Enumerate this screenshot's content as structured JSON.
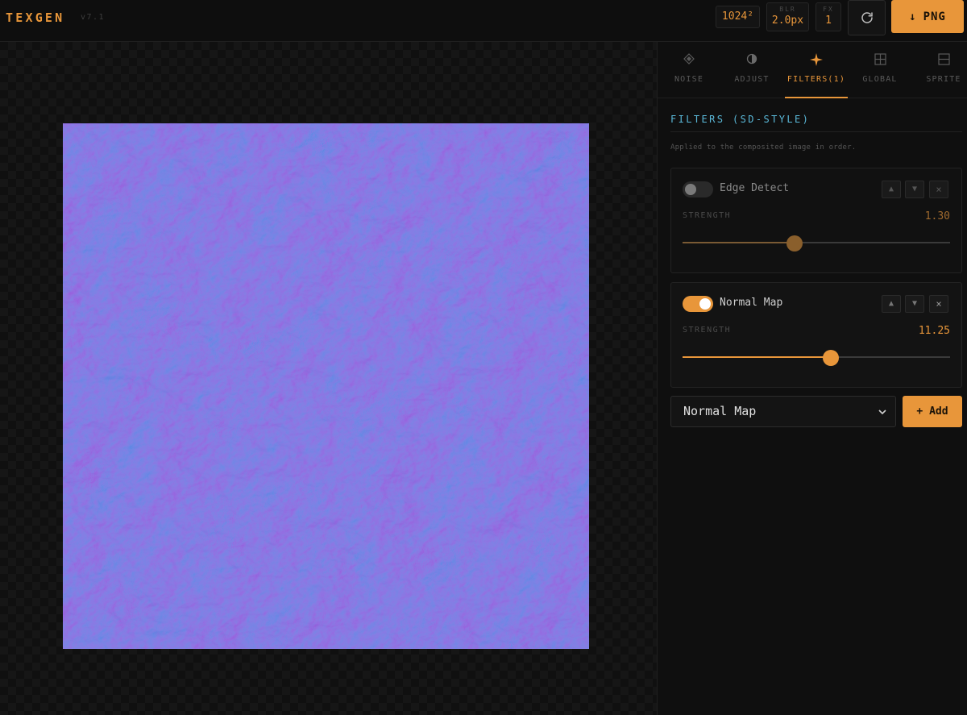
{
  "app": {
    "name": "TEXGEN",
    "version": "v7.1"
  },
  "toolbar": {
    "resolution": "1024²",
    "blur_label": "BLR",
    "blur_value": "2.0px",
    "fx_label": "FX",
    "fx_value": "1",
    "refresh_icon": "refresh-icon",
    "export_label": "PNG",
    "export_icon": "download-arrow-icon"
  },
  "tabs": [
    {
      "label": "NOISE",
      "icon": "diamond-icon"
    },
    {
      "label": "ADJUST",
      "icon": "half-circle-icon"
    },
    {
      "label": "FILTERS(1)",
      "icon": "sparkle-icon",
      "active": true
    },
    {
      "label": "GLOBAL",
      "icon": "grid-icon"
    },
    {
      "label": "SPRITE",
      "icon": "sprite-icon"
    }
  ],
  "filters_panel": {
    "title": "FILTERS (SD-STYLE)",
    "description": "Applied to the composited image in order.",
    "strength_label": "STRENGTH",
    "filters": [
      {
        "name": "Edge Detect",
        "enabled": false,
        "strength": "1.30",
        "strength_fraction": 0.42
      },
      {
        "name": "Normal Map",
        "enabled": true,
        "strength": "11.25",
        "strength_fraction": 0.555
      }
    ],
    "up_glyph": "▲",
    "down_glyph": "▼",
    "remove_glyph": "×",
    "add_select_value": "Normal Map",
    "add_button_label": "+ Add"
  },
  "colors": {
    "accent": "#e8963a",
    "section_title": "#5ab8d8",
    "normal_map_base": "#8a8aff"
  }
}
